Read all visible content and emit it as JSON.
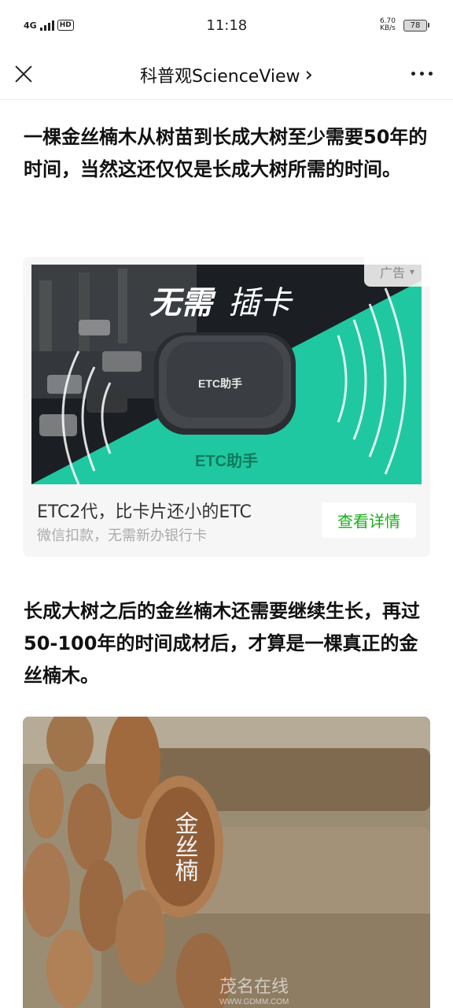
{
  "status": {
    "network": "4G",
    "hd": "HD",
    "time": "11:18",
    "speed": "6.70",
    "speed_unit": "KB/s",
    "battery": "78"
  },
  "header": {
    "title": "科普观ScienceView",
    "chevron": "›"
  },
  "article": {
    "para1": "一棵金丝楠木从树苗到长成大树至少需要50年的时间，当然这还仅仅是长成大树所需的时间。",
    "para2": "长成大树之后的金丝楠木还需要继续生长，再过50-100年的时间成材后，才算是一棵真正的金丝楠木。"
  },
  "ad": {
    "tag": "广告",
    "headline_bold": "无需",
    "headline_rest": "插卡",
    "device_label": "ETC助手",
    "brand": "ETC助手",
    "title": "ETC2代，比卡片还小的ETC",
    "subtitle": "微信扣款，无需新办银行卡",
    "button": "查看详情"
  },
  "photo": {
    "carved_text": "金丝楠",
    "watermark": "茂名在线",
    "watermark_url": "WWW.GDMM.COM"
  }
}
